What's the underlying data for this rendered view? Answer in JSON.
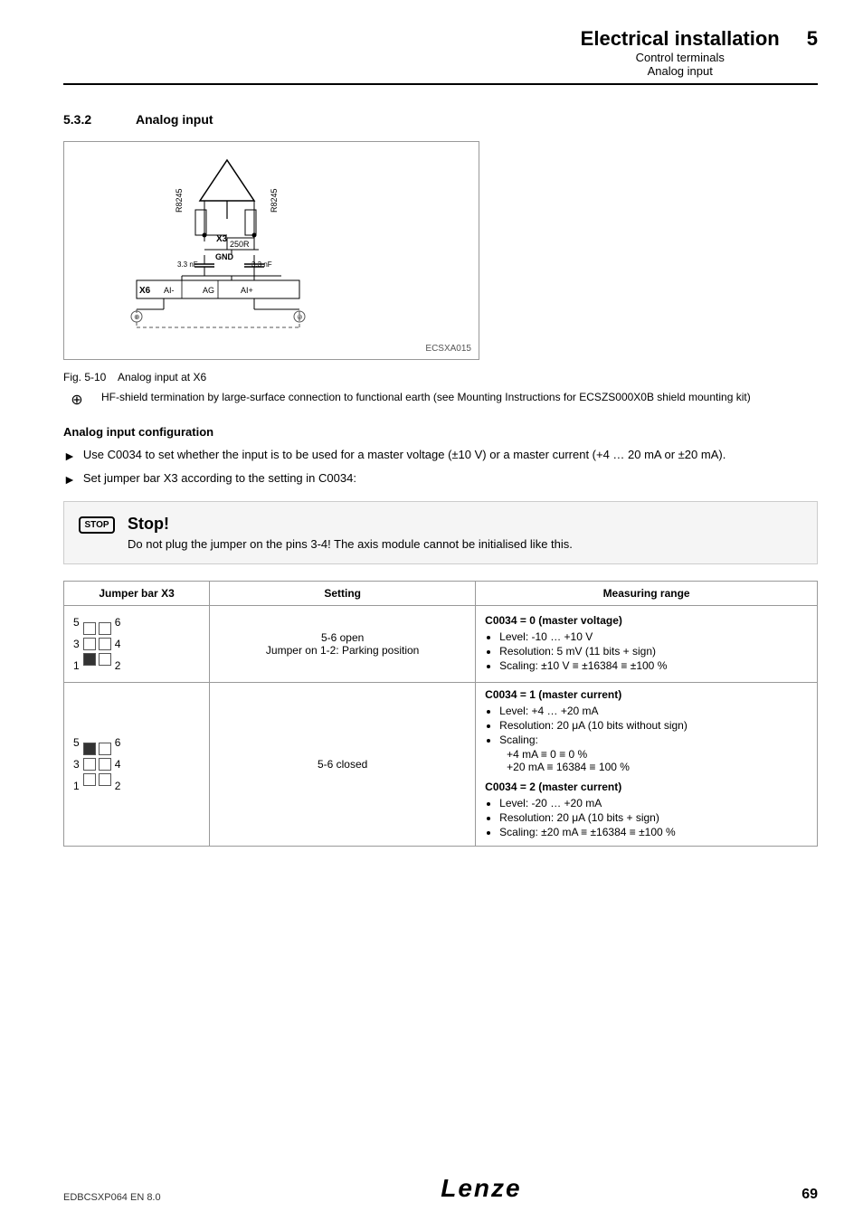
{
  "header": {
    "main_title": "Electrical installation",
    "sub1": "Control terminals",
    "sub2": "Analog input",
    "page_num": "5"
  },
  "section": {
    "number": "5.3.2",
    "title": "Analog input"
  },
  "diagram": {
    "fig_num": "Fig. 5-10",
    "fig_caption": "Analog input at X6",
    "diagram_ref": "ECSXA015",
    "symbol_note": "HF-shield termination by large-surface connection to functional earth (see Mounting Instructions for ECSZS000X0B shield mounting kit)"
  },
  "config": {
    "title": "Analog input configuration",
    "bullets": [
      "Use C0034 to set whether the input is to be used for a master voltage (±10 V) or a master current (+4 … 20 mA or ±20 mA).",
      "Set jumper bar X3 according to the setting in C0034:"
    ]
  },
  "stop_box": {
    "icon_label": "STOP",
    "title": "Stop!",
    "text": "Do not plug the jumper on the pins 3-4! The axis module cannot be initialised like this."
  },
  "table": {
    "headers": [
      "Jumper bar X3",
      "Setting",
      "Measuring range"
    ],
    "rows": [
      {
        "jumper_type": "parking",
        "setting": "5-6 open\nJumper on 1-2: Parking position",
        "measuring_title": "C0034 = 0 (master voltage)",
        "measuring_items": [
          "Level: -10 … +10 V",
          "Resolution: 5 mV (11 bits + sign)",
          "Scaling: ±10 V ≡ ±16384 ≡ ±100 %"
        ]
      },
      {
        "jumper_type": "closed",
        "setting": "5-6 closed",
        "measuring_title1": "C0034 = 1 (master current)",
        "measuring_items1": [
          "Level: +4 … +20 mA",
          "Resolution: 20 μA (10 bits without sign)",
          "Scaling:",
          "+4 mA ≡ 0 ≡ 0 %",
          "+20 mA ≡ 16384 ≡ 100 %"
        ],
        "measuring_title2": "C0034 = 2 (master current)",
        "measuring_items2": [
          "Level: -20 … +20 mA",
          "Resolution: 20 μA (10 bits + sign)",
          "Scaling: ±20 mA ≡ ±16384 ≡ ±100 %"
        ]
      }
    ]
  },
  "footer": {
    "ref": "EDBCSXP064  EN  8.0",
    "logo": "Lenze",
    "page": "69"
  }
}
